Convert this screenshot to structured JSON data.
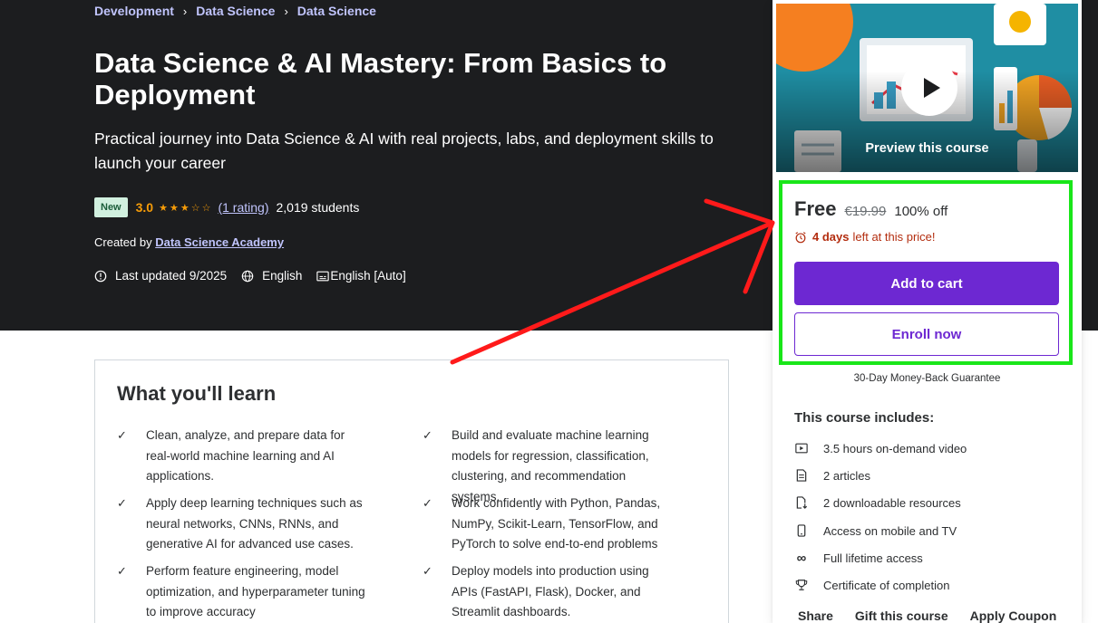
{
  "breadcrumb": [
    "Development",
    "Data Science",
    "Data Science"
  ],
  "course": {
    "title": "Data Science & AI Mastery: From Basics to Deployment",
    "subtitle": "Practical journey into Data Science & AI with real projects, labs, and deployment skills to launch your career",
    "badge": "New",
    "rating": "3.0",
    "stars_filled": 3,
    "stars_total": 5,
    "rating_count": "(1 rating)",
    "students": "2,019 students",
    "created_by_label": "Created by",
    "instructor": "Data Science Academy",
    "last_updated": "Last updated 9/2025",
    "language": "English",
    "captions": "English [Auto]"
  },
  "learn": {
    "title": "What you'll learn",
    "items": [
      "Clean, analyze, and prepare data for real-world machine learning and AI applications.",
      "Build and evaluate machine learning models for regression, classification, clustering, and recommendation systems.",
      "Apply deep learning techniques such as neural networks, CNNs, RNNs, and generative AI for advanced use cases.",
      "Work confidently with Python, Pandas, NumPy, Scikit-Learn, TensorFlow, and PyTorch to solve end-to-end problems",
      "Perform feature engineering, model optimization, and hyperparameter tuning to improve accuracy",
      "Deploy models into production using APIs (FastAPI, Flask), Docker, and Streamlit dashboards."
    ]
  },
  "sidebar": {
    "preview_label": "Preview this course",
    "price_now": "Free",
    "price_old": "€19.99",
    "discount": "100% off",
    "timer_strong": "4 days",
    "timer_rest": "left at this price!",
    "add_to_cart": "Add to cart",
    "enroll_now": "Enroll now",
    "guarantee": "30-Day Money-Back Guarantee",
    "includes_title": "This course includes:",
    "includes": [
      {
        "icon": "video-icon",
        "text": "3.5 hours on-demand video"
      },
      {
        "icon": "article-icon",
        "text": "2 articles"
      },
      {
        "icon": "download-icon",
        "text": "2 downloadable resources"
      },
      {
        "icon": "mobile-icon",
        "text": "Access on mobile and TV"
      },
      {
        "icon": "infinity-icon",
        "text": "Full lifetime access"
      },
      {
        "icon": "trophy-icon",
        "text": "Certificate of completion"
      }
    ],
    "footer_links": [
      "Share",
      "Gift this course",
      "Apply Coupon"
    ]
  },
  "colors": {
    "hero_bg": "#1c1d1f",
    "accent_purple": "#6d28d2",
    "link_lavender": "#c0c4fc",
    "star_orange": "#f69c08",
    "timer_red": "#b32d0f",
    "highlight_green": "#19e619",
    "arrow_red": "#ff1a1a"
  }
}
